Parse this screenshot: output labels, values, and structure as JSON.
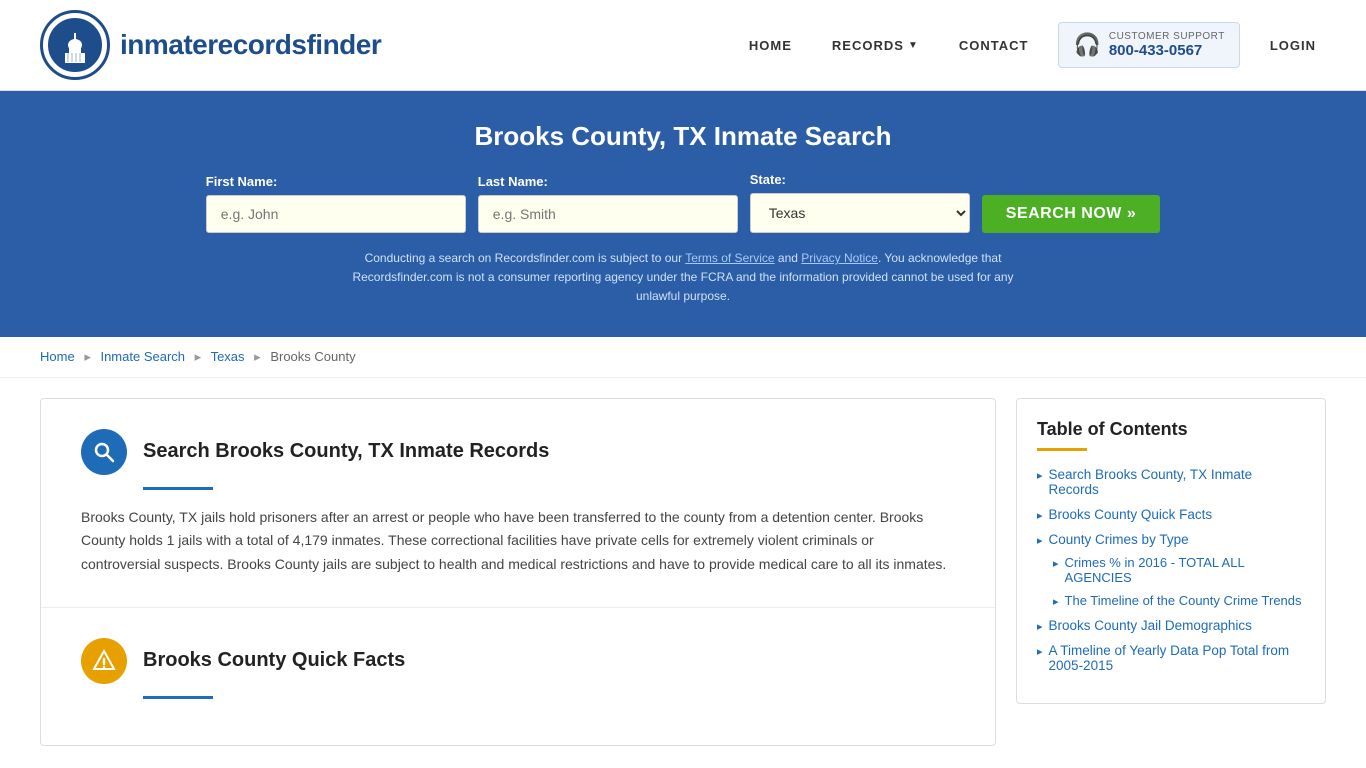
{
  "header": {
    "logo_text_light": "inmaterecords",
    "logo_text_bold": "finder",
    "nav": {
      "home_label": "HOME",
      "records_label": "RECORDS",
      "contact_label": "CONTACT",
      "support_label": "CUSTOMER SUPPORT",
      "support_number": "800-433-0567",
      "login_label": "LOGIN"
    }
  },
  "hero": {
    "title": "Brooks County, TX Inmate Search",
    "first_name_label": "First Name:",
    "first_name_placeholder": "e.g. John",
    "last_name_label": "Last Name:",
    "last_name_placeholder": "e.g. Smith",
    "state_label": "State:",
    "state_value": "Texas",
    "search_button": "SEARCH NOW »",
    "disclaimer": "Conducting a search on Recordsfinder.com is subject to our Terms of Service and Privacy Notice. You acknowledge that Recordsfinder.com is not a consumer reporting agency under the FCRA and the information provided cannot be used for any unlawful purpose.",
    "tos_text": "Terms of Service",
    "privacy_text": "Privacy Notice"
  },
  "breadcrumb": {
    "home": "Home",
    "inmate_search": "Inmate Search",
    "texas": "Texas",
    "current": "Brooks County"
  },
  "content": {
    "section1": {
      "title": "Search Brooks County, TX Inmate Records",
      "body": "Brooks County, TX jails hold prisoners after an arrest or people who have been transferred to the county from a detention center. Brooks County holds 1 jails with a total of 4,179 inmates. These correctional facilities have private cells for extremely violent criminals or controversial suspects. Brooks County jails are subject to health and medical restrictions and have to provide medical care to all its inmates."
    },
    "section2": {
      "title": "Brooks County Quick Facts"
    }
  },
  "toc": {
    "title": "Table of Contents",
    "items": [
      {
        "label": "Search Brooks County, TX Inmate Records",
        "sub": []
      },
      {
        "label": "Brooks County Quick Facts",
        "sub": []
      },
      {
        "label": "County Crimes by Type",
        "sub": [
          "Crimes % in 2016 - TOTAL ALL AGENCIES",
          "The Timeline of the County Crime Trends"
        ]
      },
      {
        "label": "Brooks County Jail Demographics",
        "sub": []
      },
      {
        "label": "A Timeline of Yearly Data Pop Total from 2005-2015",
        "sub": []
      }
    ]
  }
}
